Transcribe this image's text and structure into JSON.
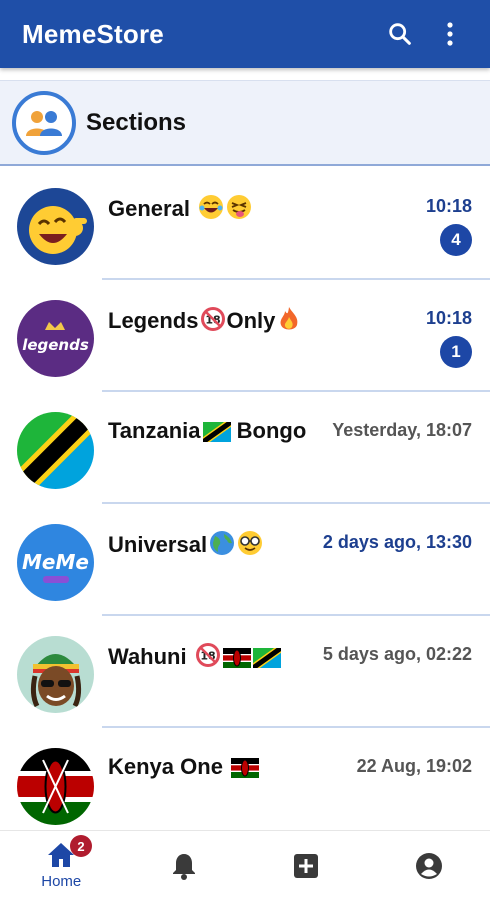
{
  "app": {
    "title": "MemeStore"
  },
  "toolbar": {
    "search_icon": "search-icon",
    "menu_icon": "more-vert-icon"
  },
  "sections": {
    "label": "Sections",
    "icon": "group-icon"
  },
  "chats": [
    {
      "name": "General",
      "emojis": [
        "laughing-tears",
        "tongue-out"
      ],
      "time": "10:18",
      "unread": "4",
      "avatar": "laughing-emoji"
    },
    {
      "name_parts": [
        "Legends",
        "Only"
      ],
      "emojis": [
        "18-plus",
        "fire"
      ],
      "time": "10:18",
      "unread": "1",
      "avatar": "legends-logo"
    },
    {
      "name_parts": [
        "Tanzania",
        " Bongo"
      ],
      "emojis": [
        "flag-tanzania"
      ],
      "time": "Yesterday, 18:07",
      "avatar": "tanzania-flag"
    },
    {
      "name": "Universal",
      "emojis": [
        "globe",
        "nerd-face"
      ],
      "time": "2 days ago, 13:30",
      "avatar": "meme-logo",
      "avatar_text": "MeMe"
    },
    {
      "name": "Wahuni ",
      "emojis": [
        "18-plus",
        "flag-kenya",
        "flag-tanzania"
      ],
      "time": "5 days ago, 02:22",
      "avatar": "rasta-cartoon"
    },
    {
      "name": "Kenya One ",
      "emojis": [
        "flag-kenya"
      ],
      "time": "22 Aug, 19:02",
      "avatar": "kenya-flag"
    }
  ],
  "bottom_nav": {
    "items": [
      {
        "label": "Home",
        "icon": "home-icon",
        "badge": "2"
      },
      {
        "icon": "bell-icon"
      },
      {
        "icon": "add-box-icon"
      },
      {
        "icon": "account-circle-icon"
      }
    ]
  },
  "colors": {
    "primary": "#1f4fa8",
    "badge": "#1d47a6",
    "notify": "#b01c2e"
  }
}
